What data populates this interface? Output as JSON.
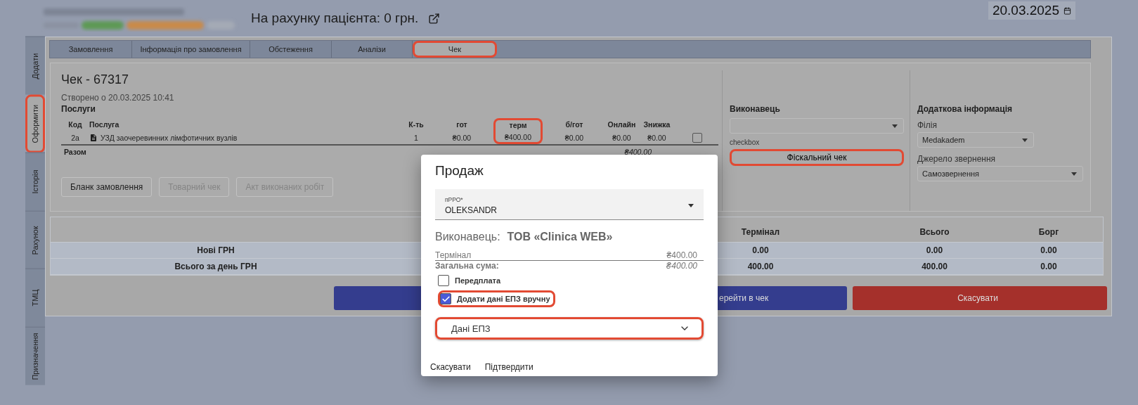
{
  "header": {
    "balance": "На рахунку пацієнта: 0 грн.",
    "date": "20.03.2025"
  },
  "side_tabs": [
    {
      "label": "Додати",
      "selected": false,
      "highlighted": false
    },
    {
      "label": "Оформити",
      "selected": true,
      "highlighted": true
    },
    {
      "label": "Історія",
      "selected": false,
      "highlighted": false
    },
    {
      "label": "Рахунок",
      "selected": false,
      "highlighted": false
    },
    {
      "label": "ТМЦ",
      "selected": false,
      "highlighted": false
    },
    {
      "label": "Призначення",
      "selected": false,
      "highlighted": false
    }
  ],
  "tabs": [
    {
      "label": "Замовлення",
      "selected": false,
      "highlighted": false
    },
    {
      "label": "Інформація про замовлення",
      "selected": false,
      "highlighted": false
    },
    {
      "label": "Обстеження",
      "selected": false,
      "highlighted": false
    },
    {
      "label": "Аналізи",
      "selected": false,
      "highlighted": false
    },
    {
      "label": "Чек",
      "selected": true,
      "highlighted": true
    }
  ],
  "receipt": {
    "title": "Чек - 67317",
    "created": "Створено о 20.03.2025 10:41",
    "section": "Послуги",
    "columns": [
      {
        "label": "Код",
        "highlighted": false
      },
      {
        "label": "Послуга",
        "highlighted": false
      },
      {
        "label": "К-ть",
        "highlighted": false
      },
      {
        "label": "гот",
        "highlighted": false
      },
      {
        "label": "терм",
        "highlighted": true
      },
      {
        "label": "б/гот",
        "highlighted": false
      },
      {
        "label": "Онлайн",
        "highlighted": false
      },
      {
        "label": "Знижка",
        "highlighted": false
      }
    ],
    "rows": [
      {
        "cells": [
          "2а",
          "УЗД заочеревинних лімфотичних вузлів",
          "1",
          "₴0.00",
          "₴400.00",
          "₴0.00",
          "₴0.00",
          "₴0.00"
        ],
        "checked": false
      }
    ],
    "total_label": "Разом",
    "total_value": "₴400.00",
    "buttons": [
      {
        "label": "Бланк замовлення",
        "disabled": false
      },
      {
        "label": "Товарний чек",
        "disabled": true
      },
      {
        "label": "Акт виконаних робіт",
        "disabled": true
      }
    ]
  },
  "performer": {
    "title": "Виконавець",
    "note": "checkbox",
    "fiscal_button": {
      "label": "Фіскальний чек",
      "highlighted": true
    }
  },
  "extra": {
    "title": "Додаткова інформація",
    "fields": [
      {
        "label": "Філія",
        "value": "Medakadem"
      },
      {
        "label": "Джерело звернення",
        "value": "Самозвернення"
      }
    ]
  },
  "summary": {
    "columns": [
      "Термінал",
      "Всього",
      "Борг"
    ],
    "rows": [
      {
        "label": "Нові ГРН",
        "values": [
          "0.00",
          "0.00",
          "0.00"
        ]
      },
      {
        "label": "Всього за день ГРН",
        "values": [
          "400.00",
          "400.00",
          "0.00"
        ]
      }
    ]
  },
  "actions": [
    {
      "label": "ерейти в чек",
      "kind": "primary"
    },
    {
      "label": "Скасувати",
      "kind": "danger"
    }
  ],
  "dialog": {
    "title": "Продаж",
    "select": {
      "label": "пРРО*",
      "value": "OLEKSANDR"
    },
    "performer_label": "Виконавець:",
    "performer_value": "ТОВ «Clinica WEB»",
    "payments": [
      {
        "label": "Термінал",
        "amount": "₴400.00"
      }
    ],
    "total_label": "Загальна сума:",
    "total_amount": "₴400.00",
    "options": [
      {
        "label": "Передплата",
        "checked": false,
        "highlighted": false
      },
      {
        "label": "Додати дані ЕПЗ вручну",
        "checked": true,
        "highlighted": true
      }
    ],
    "accordion": {
      "label": "Дані ЕПЗ",
      "expanded": false,
      "highlighted": true
    },
    "buttons": [
      "Скасувати",
      "Підтвердити"
    ]
  }
}
